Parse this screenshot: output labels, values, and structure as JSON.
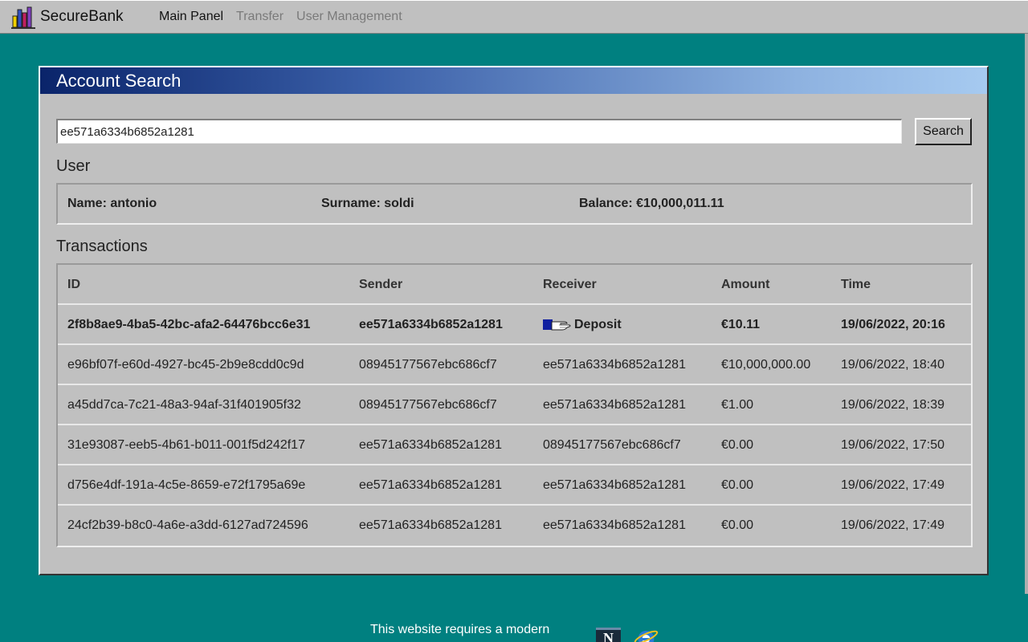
{
  "app": {
    "name": "SecureBank"
  },
  "nav": {
    "items": [
      {
        "label": "Main Panel",
        "active": true
      },
      {
        "label": "Transfer",
        "active": false
      },
      {
        "label": "User Management",
        "active": false
      }
    ]
  },
  "window": {
    "title": "Account Search"
  },
  "search": {
    "value": "ee571a6334b6852a1281",
    "button_label": "Search"
  },
  "user": {
    "section_title": "User",
    "name": "Name: antonio",
    "surname": "Surname: soldi",
    "balance": "Balance: €10,000,011.11"
  },
  "transactions": {
    "section_title": "Transactions",
    "headers": {
      "id": "ID",
      "sender": "Sender",
      "receiver": "Receiver",
      "amount": "Amount",
      "time": "Time"
    },
    "rows": [
      {
        "id": "2f8b8ae9-4ba5-42bc-afa2-64476bcc6e31",
        "sender": "ee571a6334b6852a1281",
        "receiver": "Deposit",
        "amount": "€10.11",
        "time": "19/06/2022, 20:16",
        "icon": "deposit-hand-icon"
      },
      {
        "id": "e96bf07f-e60d-4927-bc45-2b9e8cdd0c9d",
        "sender": "08945177567ebc686cf7",
        "receiver": "ee571a6334b6852a1281",
        "amount": "€10,000,000.00",
        "time": "19/06/2022, 18:40"
      },
      {
        "id": "a45dd7ca-7c21-48a3-94af-31f401905f32",
        "sender": "08945177567ebc686cf7",
        "receiver": "ee571a6334b6852a1281",
        "amount": "€1.00",
        "time": "19/06/2022, 18:39"
      },
      {
        "id": "31e93087-eeb5-4b61-b011-001f5d242f17",
        "sender": "ee571a6334b6852a1281",
        "receiver": "08945177567ebc686cf7",
        "amount": "€0.00",
        "time": "19/06/2022, 17:50"
      },
      {
        "id": "d756e4df-191a-4c5e-8659-e72f1795a69e",
        "sender": "ee571a6334b6852a1281",
        "receiver": "ee571a6334b6852a1281",
        "amount": "€0.00",
        "time": "19/06/2022, 17:49"
      },
      {
        "id": "24cf2b39-b8c0-4a6e-a3dd-6127ad724596",
        "sender": "ee571a6334b6852a1281",
        "receiver": "ee571a6334b6852a1281",
        "amount": "€0.00",
        "time": "19/06/2022, 17:49"
      }
    ]
  },
  "footer": {
    "text": "This website requires a modern",
    "badges": [
      "netscape-navigator-icon",
      "internet-explorer-icon"
    ]
  },
  "colors": {
    "background": "#008080",
    "panel": "#c0c0c0",
    "title_start": "#0a246a",
    "title_end": "#a6caf0"
  }
}
